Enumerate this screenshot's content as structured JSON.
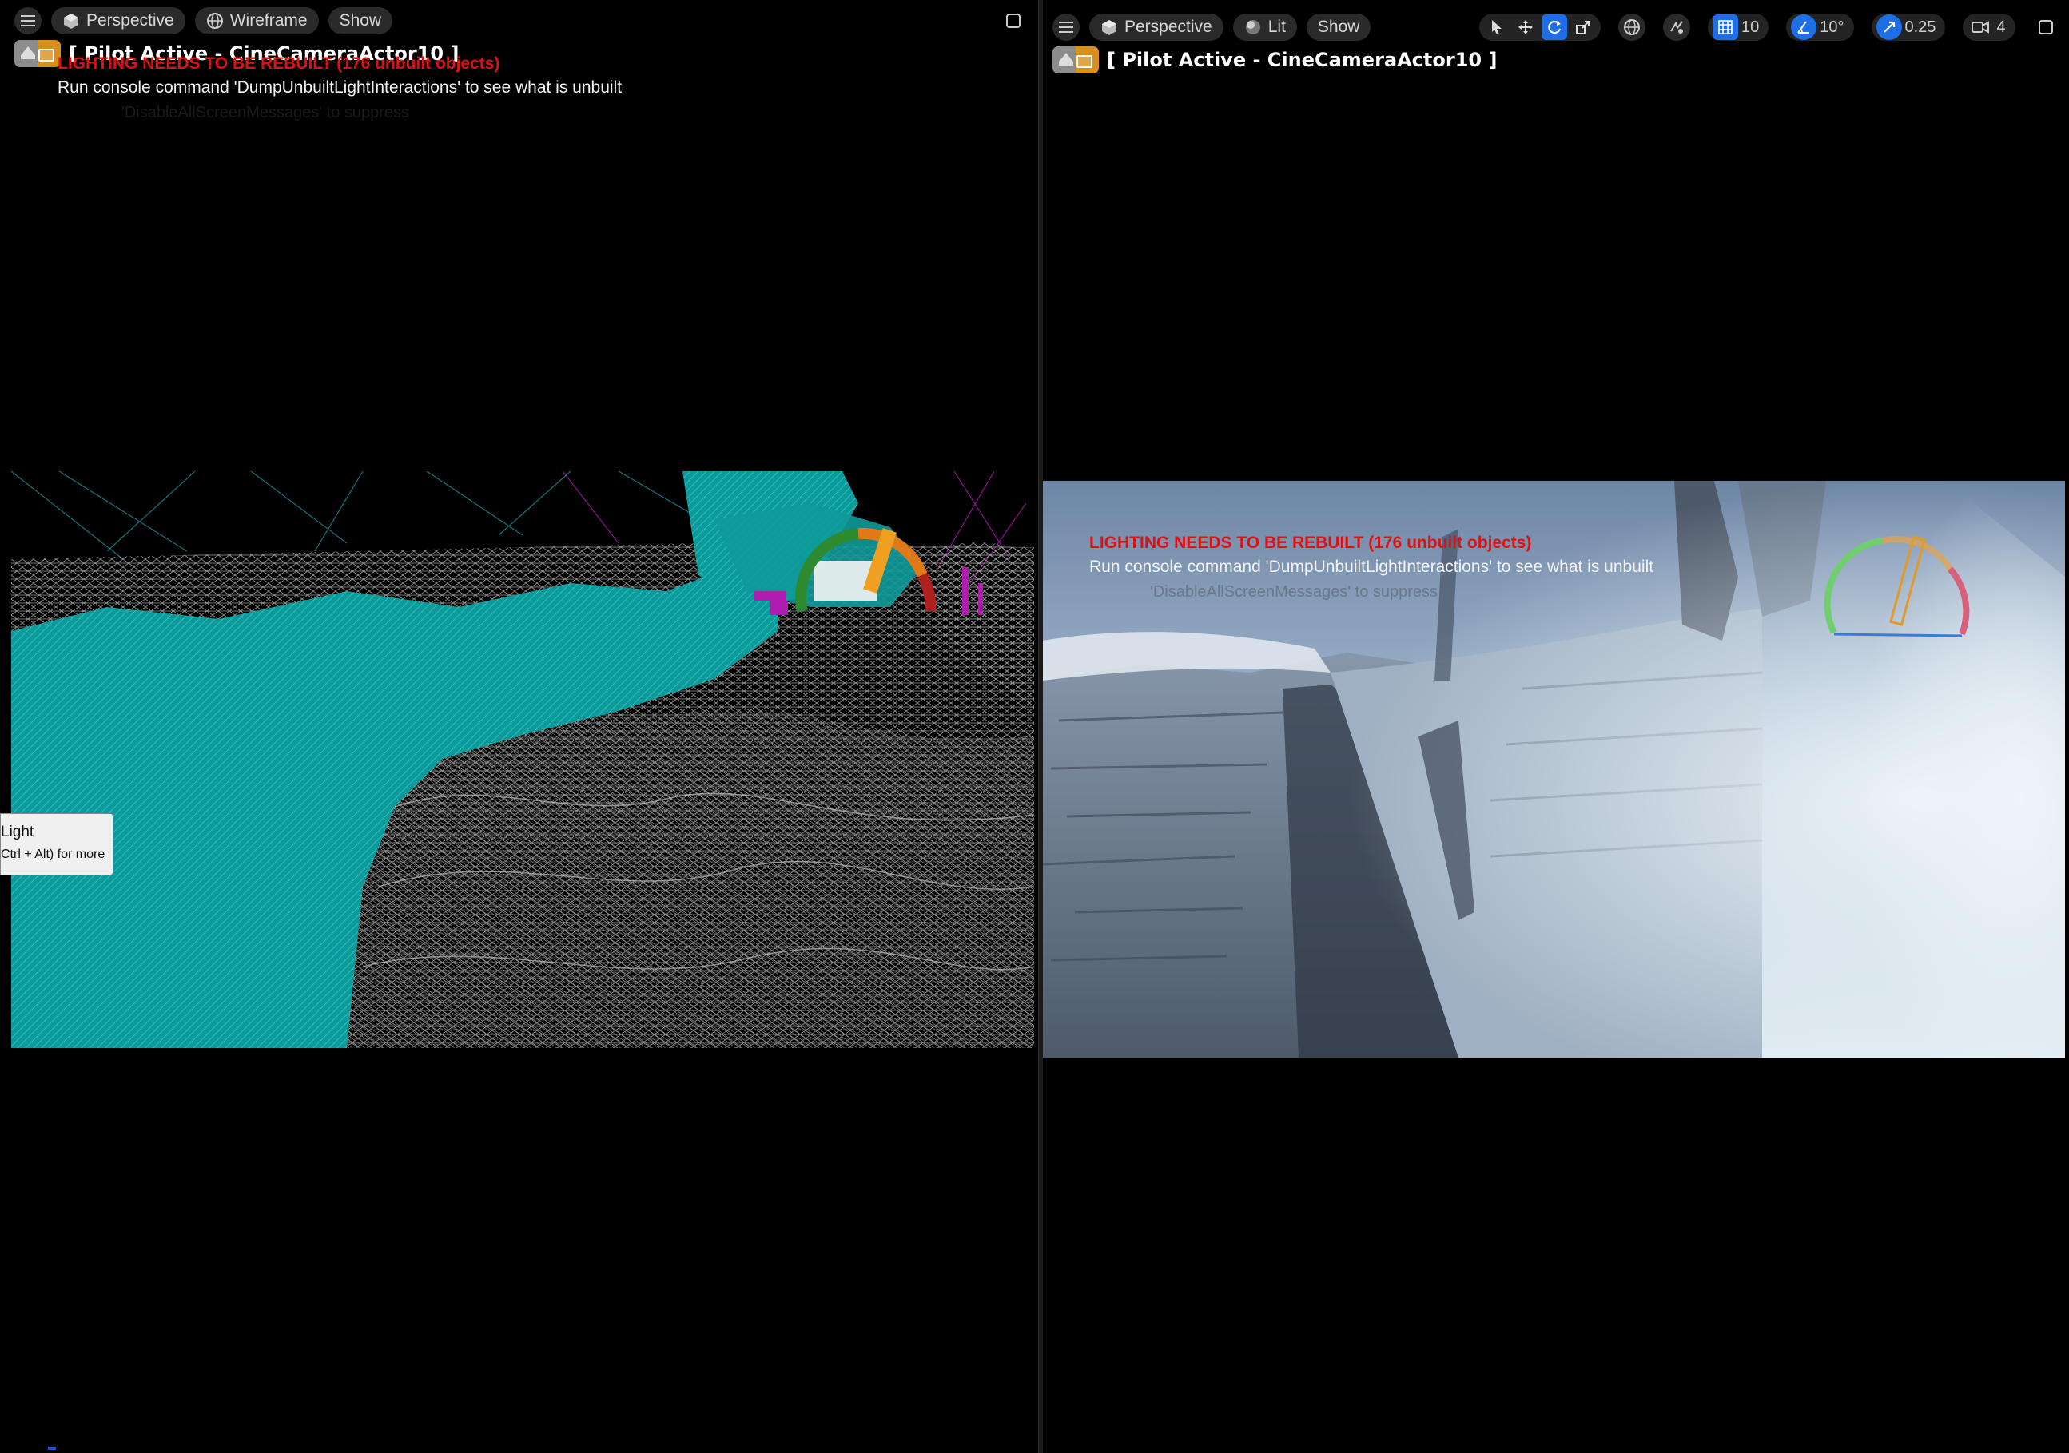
{
  "left_viewport": {
    "toolbar": {
      "menu_icon": "hamburger-icon",
      "view_mode_label": "Perspective",
      "render_mode_label": "Wireframe",
      "show_label": "Show",
      "maximize_icon": "maximize-icon"
    },
    "pilot_label": "[ Pilot Active - CineCameraActor10 ]",
    "messages": {
      "lighting": "LIGHTING NEEDS TO BE REBUILT (176 unbuilt objects)",
      "console": "Run console command 'DumpUnbuiltLightInteractions' to see what is unbuilt",
      "suppress": "'DisableAllScreenMessages' to suppress"
    },
    "tooltip": {
      "title": "Light",
      "hint": "Ctrl + Alt) for more"
    }
  },
  "right_viewport": {
    "toolbar": {
      "menu_icon": "hamburger-icon",
      "view_mode_label": "Perspective",
      "render_mode_label": "Lit",
      "show_label": "Show",
      "transform_tools": [
        "select-icon",
        "translate-icon",
        "rotate-icon",
        "scale-icon"
      ],
      "active_tool": "rotate-icon",
      "world_icon": "globe-icon",
      "surface_snap_icon": "surface-snap-icon",
      "grid_snap_value": "10",
      "rotation_snap_value": "10°",
      "scale_snap_value": "0.25",
      "camera_speed_value": "4",
      "maximize_icon": "maximize-icon",
      "layout_icon": "viewport-layout-icon"
    },
    "pilot_label": "[ Pilot Active - CineCameraActor10 ]",
    "messages": {
      "lighting": "LIGHTING NEEDS TO BE REBUILT (176 unbuilt objects)",
      "console": "Run console command 'DumpUnbuiltLightInteractions' to see what is unbuilt",
      "suppress": "'DisableAllScreenMessages' to suppress"
    }
  },
  "colors": {
    "accent": "#1e6ee8",
    "warning_red": "#e01010",
    "wire_cyan": "#12a3a3",
    "wire_magenta": "#b01cb0"
  }
}
